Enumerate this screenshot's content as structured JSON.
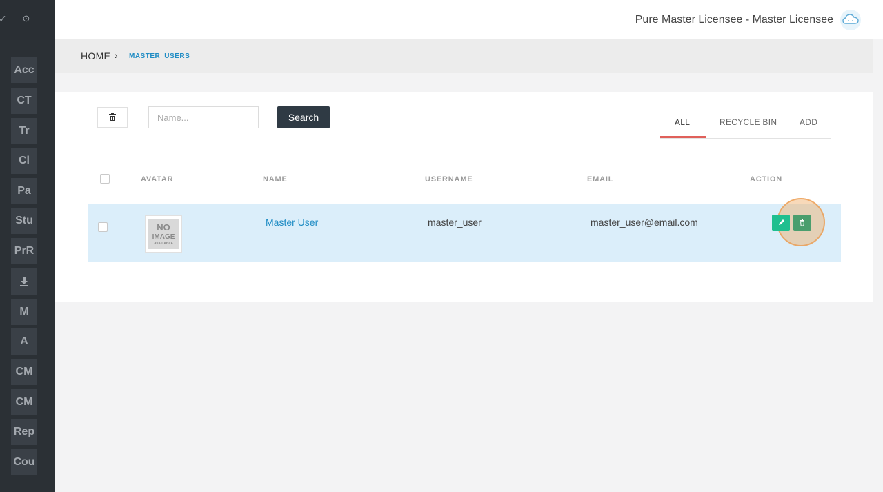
{
  "sidebar": {
    "toggle_icon": "check-icon",
    "settings_icon": "settings-icon",
    "items": [
      {
        "label": "Acc"
      },
      {
        "label": "CT"
      },
      {
        "label": "Tr"
      },
      {
        "label": "Cl"
      },
      {
        "label": "Pa"
      },
      {
        "label": "Stu"
      },
      {
        "label": "PrR"
      },
      {
        "label": "",
        "icon": "download-icon"
      },
      {
        "label": "M"
      },
      {
        "label": "A"
      },
      {
        "label": "CM"
      },
      {
        "label": "CM"
      },
      {
        "label": "Rep"
      },
      {
        "label": "Cou"
      }
    ]
  },
  "header": {
    "user_name": "Pure Master Licensee - Master Licensee",
    "avatar_icon": "cloud-avatar-icon"
  },
  "breadcrumb": {
    "home": "HOME",
    "separator": "›",
    "current": "MASTER_USERS"
  },
  "toolbar": {
    "trash_icon": "trash-icon",
    "search_placeholder": "Name...",
    "search_label": "Search"
  },
  "tabs": [
    {
      "label": "ALL",
      "active": true
    },
    {
      "label": "RECYCLE BIN",
      "active": false
    },
    {
      "label": "ADD",
      "active": false
    }
  ],
  "table": {
    "headers": {
      "avatar": "AVATAR",
      "name": "NAME",
      "username": "USERNAME",
      "email": "EMAIL",
      "action": "ACTION"
    },
    "rows": [
      {
        "avatar": "no-image-placeholder",
        "avatar_text": [
          "NO",
          "IMAGE",
          "AVAILABLE"
        ],
        "name": "Master User",
        "username": "master_user",
        "email": "master_user@email.com"
      }
    ]
  },
  "colors": {
    "sidebar_bg": "#2b3035",
    "accent_blue": "#1f8cc4",
    "tab_active": "#e0605a",
    "edit_button": "#1fbf8f",
    "delete_button": "#4a9e6e",
    "row_selected": "#dbeefa"
  }
}
